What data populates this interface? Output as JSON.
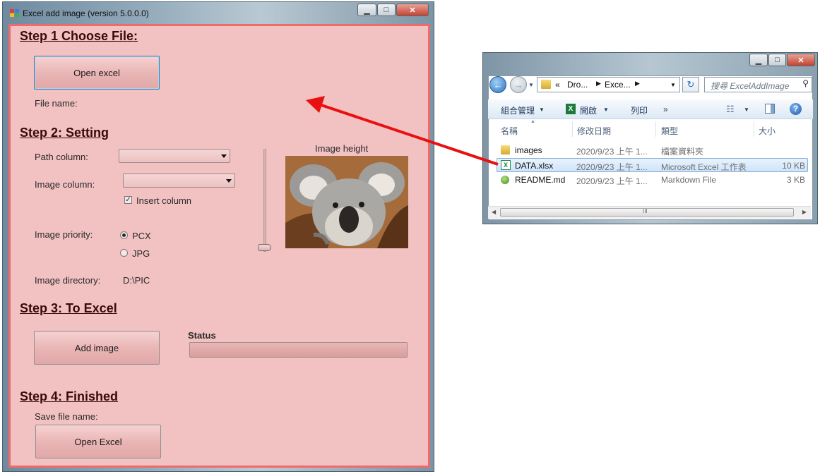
{
  "app": {
    "title": "Excel add image (version 5.0.0.0)",
    "window_controls": {
      "minimize": "▁",
      "maximize": "□",
      "close": "✕"
    },
    "step1": {
      "heading": "Step 1 Choose File:",
      "open_button": "Open excel",
      "file_name_label": "File name:"
    },
    "step2": {
      "heading": "Step 2: Setting",
      "path_column_label": "Path column:",
      "image_column_label": "Image column:",
      "insert_column_label": "Insert column",
      "insert_column_checked": true,
      "image_priority_label": "Image priority:",
      "priority_options": [
        "PCX",
        "JPG"
      ],
      "priority_selected": "PCX",
      "image_directory_label": "Image directory:",
      "image_directory_value": "D:\\PIC",
      "image_height_label": "Image height",
      "image_height_slider": 0
    },
    "step3": {
      "heading": "Step 3: To Excel",
      "add_button": "Add image",
      "status_label": "Status",
      "progress": 0
    },
    "step4": {
      "heading": "Step 4: Finished",
      "save_label": "Save file name:",
      "open_button": "Open Excel"
    }
  },
  "explorer": {
    "window_controls": {
      "minimize": "▁",
      "maximize": "□",
      "close": "✕"
    },
    "breadcrumb": [
      "«",
      "Dro...",
      "Exce...",
      ""
    ],
    "search_placeholder": "搜尋 ExcelAddImage",
    "toolbar": {
      "organize": "組合管理",
      "open": "開啟",
      "print": "列印",
      "more": "»"
    },
    "columns": [
      "名稱",
      "修改日期",
      "類型",
      "大小"
    ],
    "rows": [
      {
        "name": "images",
        "date": "2020/9/23 上午 1...",
        "type": "檔案資料夾",
        "size": "",
        "icon": "folder-icon"
      },
      {
        "name": "DATA.xlsx",
        "date": "2020/9/23 上午 1...",
        "type": "Microsoft Excel 工作表",
        "size": "10 KB",
        "icon": "excel-file-icon",
        "selected": true
      },
      {
        "name": "README.md",
        "date": "2020/9/23 上午 1...",
        "type": "Markdown File",
        "size": "3 KB",
        "icon": "markdown-file-icon"
      }
    ],
    "scrollbar_grip": "III"
  },
  "colors": {
    "panel_bg": "#f2c1c1",
    "panel_border": "#ee6b6b",
    "arrow": "#e81010",
    "selection": "#cfe4fa"
  }
}
